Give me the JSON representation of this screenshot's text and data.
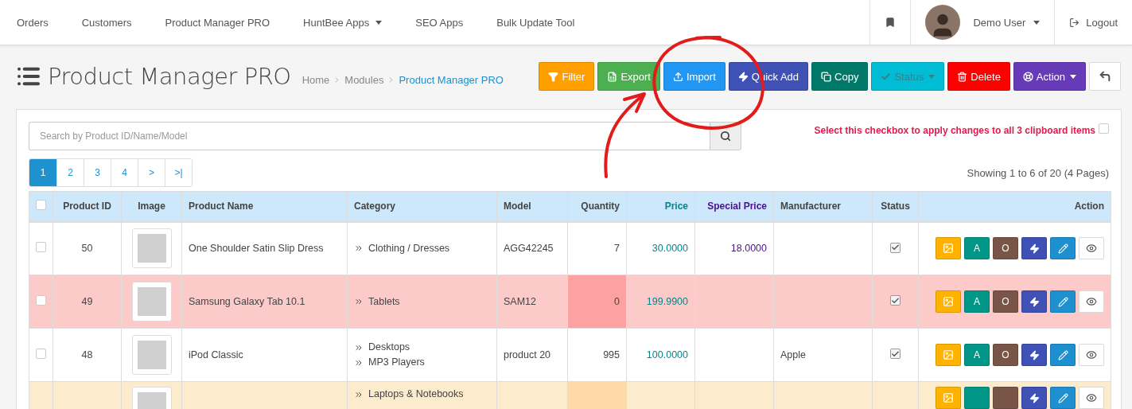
{
  "navbar": {
    "items": [
      {
        "label": "Orders",
        "dropdown": false
      },
      {
        "label": "Customers",
        "dropdown": false
      },
      {
        "label": "Product Manager PRO",
        "dropdown": false
      },
      {
        "label": "HuntBee Apps",
        "dropdown": true
      },
      {
        "label": "SEO Apps",
        "dropdown": false
      },
      {
        "label": "Bulk Update Tool",
        "dropdown": false
      }
    ],
    "user": "Demo User",
    "logout": "Logout"
  },
  "header": {
    "title": "Product Manager PRO",
    "breadcrumb": [
      {
        "label": "Home",
        "current": false
      },
      {
        "label": "Modules",
        "current": false
      },
      {
        "label": "Product Manager PRO",
        "current": true
      }
    ]
  },
  "toolbar": [
    {
      "kind": "filter",
      "label": "Filter",
      "color": "#ffa000",
      "dropdown": false
    },
    {
      "kind": "export",
      "label": "Export",
      "color": "#4caf50",
      "dropdown": false
    },
    {
      "kind": "import",
      "label": "Import",
      "color": "#2196f3",
      "dropdown": false
    },
    {
      "kind": "quick",
      "label": "Quick Add",
      "color": "#3f51b5",
      "dropdown": false
    },
    {
      "kind": "copy",
      "label": "Copy",
      "color": "#00796b",
      "dropdown": false
    },
    {
      "kind": "status",
      "label": "Status",
      "color": "#00bcd4",
      "dropdown": true
    },
    {
      "kind": "delete",
      "label": "Delete",
      "color": "#ff0000",
      "dropdown": false
    },
    {
      "kind": "action",
      "label": "Action",
      "color": "#673ab7",
      "dropdown": true
    },
    {
      "kind": "back",
      "color": "#ffffff",
      "dropdown": false
    }
  ],
  "search": {
    "placeholder": "Search by Product ID/Name/Model"
  },
  "clipboard": {
    "label": "Select this checkbox to apply changes to all 3 clipboard items",
    "checked": false
  },
  "pagination": [
    {
      "label": "1",
      "selected": true
    },
    {
      "label": "2",
      "selected": false
    },
    {
      "label": "3",
      "selected": false
    },
    {
      "label": "4",
      "selected": false
    },
    {
      "label": ">",
      "selected": false
    },
    {
      "label": ">|",
      "selected": false
    }
  ],
  "showing": "Showing 1 to 6 of 20 (4 Pages)",
  "table": {
    "select_all": false,
    "columns": [
      "Product ID",
      "Image",
      "Product Name",
      "Category",
      "Model",
      "Quantity",
      "Price",
      "Special Price",
      "Manufacturer",
      "Status",
      "Action"
    ],
    "rows": [
      {
        "selected": false,
        "alert": false,
        "warning": false,
        "id": "50",
        "name": "One Shoulder Satin Slip Dress",
        "categories": [
          "Clothing / Dresses"
        ],
        "model": "AGG42245",
        "quantity": "7",
        "price": "30.0000",
        "special": "18.0000",
        "manufacturer": "",
        "status": true,
        "actions": [
          {
            "kind": "image",
            "color": "#ffb300"
          },
          {
            "kind": "text",
            "label": "A",
            "color": "#009688"
          },
          {
            "kind": "text",
            "label": "O",
            "color": "#795548"
          },
          {
            "kind": "quick",
            "color": "#3f51b5"
          },
          {
            "kind": "edit",
            "color": "#1e90d0"
          },
          {
            "kind": "view",
            "color": "#ffffff"
          }
        ]
      },
      {
        "selected": false,
        "alert": true,
        "warning": false,
        "id": "49",
        "name": "Samsung Galaxy Tab 10.1",
        "categories": [
          "Tablets"
        ],
        "model": "SAM12",
        "quantity": "0",
        "price": "199.9900",
        "special": "",
        "manufacturer": "",
        "status": true,
        "actions": [
          {
            "kind": "image",
            "color": "#ffb300"
          },
          {
            "kind": "text",
            "label": "A",
            "color": "#009688"
          },
          {
            "kind": "text",
            "label": "O",
            "color": "#795548"
          },
          {
            "kind": "quick",
            "color": "#3f51b5"
          },
          {
            "kind": "edit",
            "color": "#1e90d0"
          },
          {
            "kind": "view",
            "color": "#ffffff"
          }
        ]
      },
      {
        "selected": false,
        "alert": false,
        "warning": false,
        "id": "48",
        "name": "iPod Classic",
        "categories": [
          "Desktops",
          "MP3 Players"
        ],
        "model": "product 20",
        "quantity": "995",
        "price": "100.0000",
        "special": "",
        "manufacturer": "Apple",
        "status": true,
        "actions": [
          {
            "kind": "image",
            "color": "#ffb300"
          },
          {
            "kind": "text",
            "label": "A",
            "color": "#009688"
          },
          {
            "kind": "text",
            "label": "O",
            "color": "#795548"
          },
          {
            "kind": "quick",
            "color": "#3f51b5"
          },
          {
            "kind": "edit",
            "color": "#1e90d0"
          },
          {
            "kind": "view",
            "color": "#ffffff"
          }
        ]
      },
      {
        "alert": false,
        "warning": true,
        "cut_off": true,
        "id": "",
        "name": "",
        "categories": [
          "Laptops & Notebooks"
        ],
        "model": "",
        "quantity": "",
        "price": "",
        "special": "",
        "manufacturer": "",
        "actions": [
          {
            "kind": "image",
            "color": "#ffb300"
          },
          {
            "kind": "text",
            "color": "#009688"
          },
          {
            "kind": "text",
            "color": "#795548"
          },
          {
            "kind": "quick",
            "color": "#3f51b5"
          },
          {
            "kind": "edit",
            "color": "#1e90d0"
          },
          {
            "kind": "view",
            "color": "#ffffff"
          }
        ]
      }
    ]
  }
}
